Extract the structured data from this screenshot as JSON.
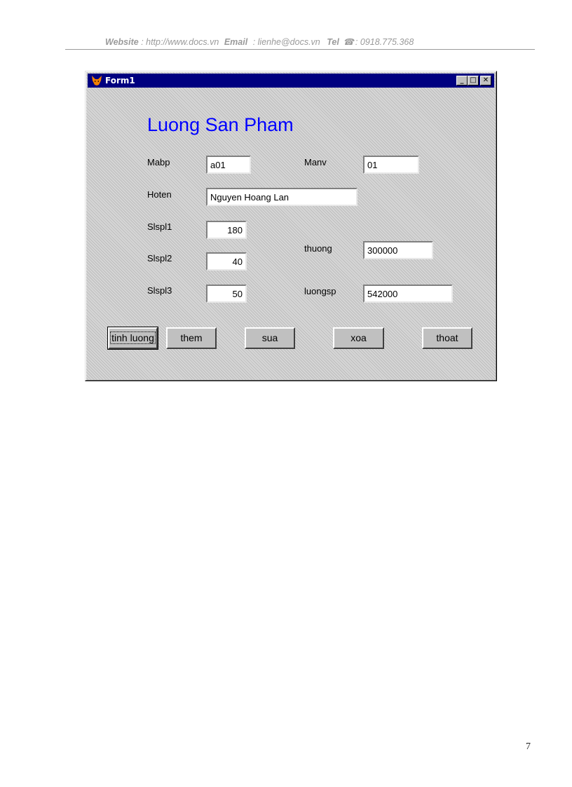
{
  "header": {
    "website_label": "Website",
    "website_value": ": http://www.docs.vn",
    "email_label": "Email",
    "email_value": ": lienhe@docs.vn",
    "tel_label": "Tel",
    "tel_value": ": 0918.775.368"
  },
  "window": {
    "title": "Form1",
    "heading": "Luong San Pham",
    "labels": {
      "mabp": "Mabp",
      "manv": "Manv",
      "hoten": "Hoten",
      "slspl1": "Slspl1",
      "slspl2": "Slspl2",
      "slspl3": "Slspl3",
      "thuong": "thuong",
      "luongsp": "luongsp"
    },
    "fields": {
      "mabp": "a01",
      "manv": "01",
      "hoten": "Nguyen Hoang Lan",
      "slspl1": "180",
      "slspl2": "40",
      "slspl3": "50",
      "thuong": "300000",
      "luongsp": "542000"
    },
    "buttons": {
      "tinh_luong": "tinh luong",
      "them": "them",
      "sua": "sua",
      "xoa": "xoa",
      "thoat": "thoat"
    }
  },
  "page_number": "7"
}
